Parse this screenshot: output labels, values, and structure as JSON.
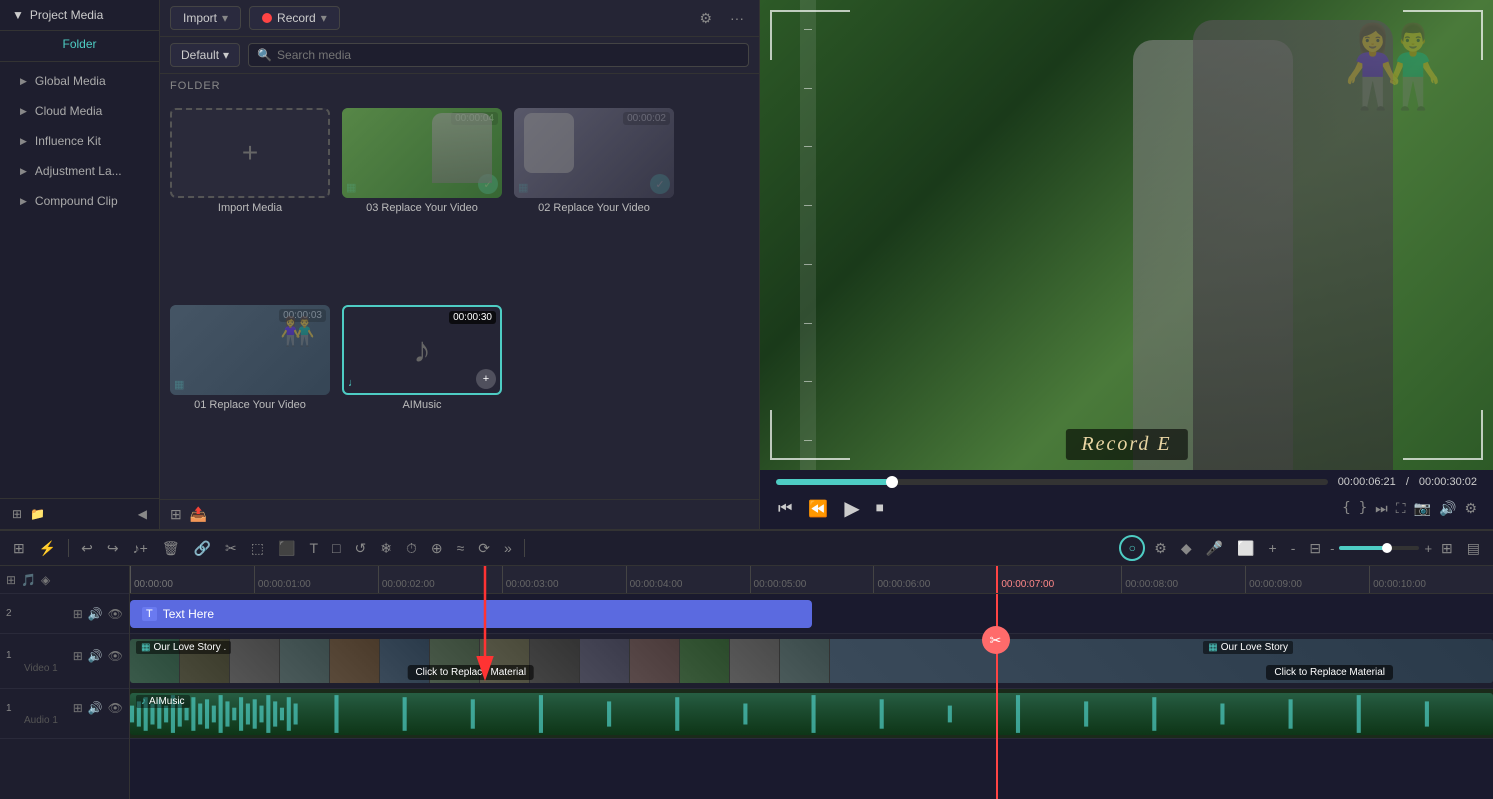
{
  "sidebar": {
    "title": "Project Media",
    "items": [
      {
        "label": "Project Media",
        "active": true,
        "id": "project-media"
      },
      {
        "label": "Folder",
        "active": true,
        "sub": true,
        "id": "folder"
      },
      {
        "label": "Global Media",
        "active": false,
        "id": "global-media"
      },
      {
        "label": "Cloud Media",
        "active": false,
        "id": "cloud-media"
      },
      {
        "label": "Influence Kit",
        "active": false,
        "id": "influence-kit"
      },
      {
        "label": "Adjustment La...",
        "active": false,
        "id": "adjustment-layer"
      },
      {
        "label": "Compound Clip",
        "active": false,
        "id": "compound-clip"
      }
    ]
  },
  "media_panel": {
    "import_label": "Import",
    "record_label": "Record",
    "filter_label": "Default",
    "search_placeholder": "Search media",
    "folder_label": "FOLDER",
    "items": [
      {
        "id": "import",
        "type": "import",
        "label": "Import Media"
      },
      {
        "id": "video1",
        "type": "video",
        "label": "03 Replace Your Video",
        "duration": "00:00:04",
        "checked": true
      },
      {
        "id": "video2",
        "type": "video",
        "label": "02 Replace Your Video",
        "duration": "00:00:02",
        "checked": true
      },
      {
        "id": "video3",
        "type": "video",
        "label": "01 Replace Your Video",
        "duration": "00:00:03",
        "checked": false
      },
      {
        "id": "audio1",
        "type": "audio",
        "label": "AIMusic",
        "duration": "00:00:30",
        "add": true
      }
    ]
  },
  "preview": {
    "title": "Record E",
    "current_time": "00:00:06:21",
    "total_time": "00:00:30:02",
    "progress_percent": 21
  },
  "timeline": {
    "tracks": [
      {
        "id": "video2-track",
        "type": "video",
        "badge": "2",
        "label": ""
      },
      {
        "id": "video1-track",
        "type": "video",
        "badge": "1",
        "label": "Video 1"
      },
      {
        "id": "audio1-track",
        "type": "audio",
        "badge": "1",
        "label": "Audio 1"
      }
    ],
    "text_clip_label": "Text Here",
    "video_clip_label": "Our Love Story .",
    "video_clip2_label": "Our Love Story",
    "audio_clip_label": "AIMusic",
    "replace_material": "Click to Replace Material",
    "ruler_marks": [
      "00:00:00",
      "00:00:01:00",
      "00:00:02:00",
      "00:00:03:00",
      "00:00:04:00",
      "00:00:05:00",
      "00:00:06:00",
      "00:00:07:00",
      "00:00:08:00",
      "00:00:09:00",
      "00:00:10:00"
    ]
  },
  "controls": {
    "rewind": "⏮",
    "play": "⏵",
    "play_alt": "▶",
    "stop": "⏹",
    "bracket_l": "{",
    "bracket_r": "}",
    "forward_icon": "⏭"
  }
}
